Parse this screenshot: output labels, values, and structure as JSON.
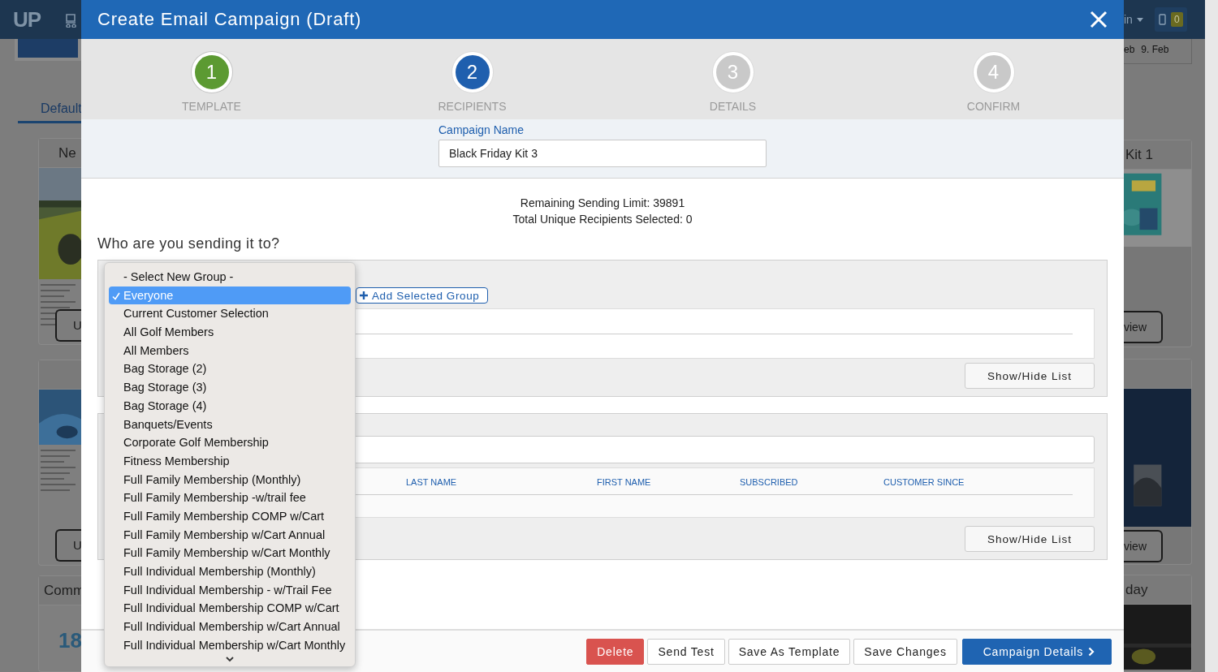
{
  "background": {
    "logo": "UP",
    "tab": "Default",
    "account_menu": "in",
    "notification_count": "0",
    "dates": [
      "eb",
      "9. Feb"
    ],
    "left_cards": [
      {
        "title": "Ne",
        "button": "U"
      },
      {
        "button": "U"
      },
      {
        "title": "Comm",
        "number": "18"
      }
    ],
    "right_cards": [
      {
        "title": "Kit 1",
        "button": "view"
      },
      {
        "button": "view"
      },
      {
        "title": "day"
      }
    ]
  },
  "dialog": {
    "title": "Create Email Campaign (Draft)",
    "steps": [
      {
        "number": "1",
        "label": "TEMPLATE",
        "completed": true,
        "selected": false
      },
      {
        "number": "2",
        "label": "RECIPIENTS",
        "completed": false,
        "selected": true
      },
      {
        "number": "3",
        "label": "DETAILS",
        "completed": false,
        "selected": false
      },
      {
        "number": "4",
        "label": "CONFIRM",
        "completed": false,
        "selected": false
      }
    ],
    "campaign_name": {
      "label": "Campaign Name",
      "value": "Black Friday Kit 3"
    },
    "sending_limit": "Remaining Sending Limit: 39891",
    "recipients_selected": "Total Unique Recipients Selected: 0",
    "question": "Who are you sending it to?",
    "add_group_button": "Add Selected Group",
    "show_hide_buttons": [
      "Show/Hide List",
      "Show/Hide List"
    ],
    "table_columns": [
      "LAST NAME",
      "FIRST NAME",
      "SUBSCRIBED",
      "CUSTOMER SINCE"
    ],
    "group_dropdown": {
      "options": [
        {
          "label": "- Select New Group -",
          "selected": false
        },
        {
          "label": "Everyone",
          "selected": true
        },
        {
          "label": "Current Customer Selection",
          "selected": false
        },
        {
          "label": "All Golf Members",
          "selected": false
        },
        {
          "label": "All Members",
          "selected": false
        },
        {
          "label": "Bag Storage (2)",
          "selected": false
        },
        {
          "label": "Bag Storage (3)",
          "selected": false
        },
        {
          "label": "Bag Storage (4)",
          "selected": false
        },
        {
          "label": "Banquets/Events",
          "selected": false
        },
        {
          "label": "Corporate Golf Membership",
          "selected": false
        },
        {
          "label": "Fitness Membership",
          "selected": false
        },
        {
          "label": "Full Family Membership (Monthly)",
          "selected": false
        },
        {
          "label": "Full Family Membership -w/trail fee",
          "selected": false
        },
        {
          "label": "Full Family Membership COMP w/Cart",
          "selected": false
        },
        {
          "label": "Full Family Membership w/Cart Annual",
          "selected": false
        },
        {
          "label": "Full Family Membership w/Cart Monthly",
          "selected": false
        },
        {
          "label": "Full Individual Membership (Monthly)",
          "selected": false
        },
        {
          "label": "Full Individual Membership - w/Trail Fee",
          "selected": false
        },
        {
          "label": "Full Individual Membership COMP w/Cart",
          "selected": false
        },
        {
          "label": "Full Individual Membership w/Cart Annual",
          "selected": false
        },
        {
          "label": "Full Individual Membership w/Cart Monthly",
          "selected": false
        }
      ]
    },
    "footer_buttons": [
      {
        "label": "Delete",
        "kind": "danger"
      },
      {
        "label": "Send Test",
        "kind": "default"
      },
      {
        "label": "Save As Template",
        "kind": "default"
      },
      {
        "label": "Save Changes",
        "kind": "default"
      },
      {
        "label": "Campaign Details",
        "kind": "primary"
      }
    ]
  }
}
